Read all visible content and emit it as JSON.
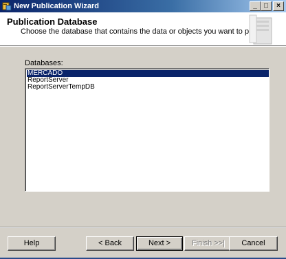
{
  "window": {
    "title": "New Publication Wizard"
  },
  "header": {
    "title": "Publication Database",
    "subtitle": "Choose the database that contains the data or objects you want to publish."
  },
  "databases": {
    "label": "Databases:",
    "items": [
      "MERCADO",
      "ReportServer",
      "ReportServerTempDB"
    ],
    "selected": "MERCADO"
  },
  "buttons": {
    "help": "Help",
    "back": "< Back",
    "next": "Next >",
    "finish": "Finish >>|",
    "cancel": "Cancel"
  },
  "colors": {
    "selection": "#0a246a",
    "dialog": "#d4d0c8"
  }
}
